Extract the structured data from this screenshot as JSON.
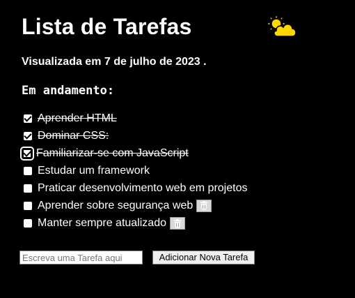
{
  "header": {
    "title": "Lista de Tarefas",
    "weather_icon": "sun-behind-cloud-icon",
    "date_text": "Visualizada em 7 de julho de 2023 ."
  },
  "section": {
    "title": "Em andamento:"
  },
  "tasks": [
    {
      "label": "Aprender HTML",
      "checked": true,
      "removable": false
    },
    {
      "label": "Dominar CSS:",
      "checked": true,
      "removable": false
    },
    {
      "label": "Familiarizar-se com JavaScript",
      "checked": true,
      "removable": false
    },
    {
      "label": "Estudar um framework",
      "checked": false,
      "removable": false
    },
    {
      "label": "Praticar desenvolvimento web em projetos",
      "checked": false,
      "removable": false
    },
    {
      "label": "Aprender sobre segurança web",
      "checked": false,
      "removable": true
    },
    {
      "label": "Manter sempre atualizado",
      "checked": false,
      "removable": true
    }
  ],
  "form": {
    "placeholder": "Escreva uma Tarefa aqui",
    "value": "",
    "add_label": "Adicionar Nova Tarefa"
  },
  "colors": {
    "background": "#000000",
    "text": "#ffffff",
    "icon_yellow": "#ffd700",
    "trash_button": "#d9d9d9"
  }
}
